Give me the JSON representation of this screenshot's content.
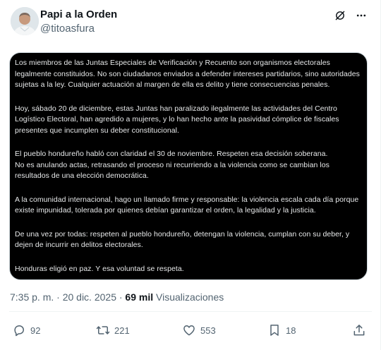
{
  "author": {
    "display_name": "Papi a la Orden",
    "handle": "@titoasfura"
  },
  "post": {
    "paragraphs": [
      "Los miembros de las Juntas Especiales de Verificación y Recuento son organismos electorales legalmente constituidos. No son ciudadanos enviados a defender intereses partidarios, sino autoridades sujetas a la ley. Cualquier actuación al margen de ella es delito y tiene consecuencias penales.",
      "Hoy, sábado 20 de diciembre, estas Juntas han paralizado ilegalmente las actividades del Centro Logístico Electoral, han agredido a mujeres, y lo han hecho ante la pasividad cómplice de fiscales presentes que incumplen su deber constitucional.",
      "El pueblo hondureño habló con claridad el 30 de noviembre. Respeten esa decisión soberana.\nNo es anulando actas, retrasando el proceso ni recurriendo a la violencia como se cambian los resultados de una elección democrática.",
      "A la comunidad internacional, hago un llamado firme y responsable: la violencia escala cada día porque existe impunidad, tolerada por quienes debían garantizar el orden, la legalidad y la justicia.",
      "De una vez por todas: respeten al pueblo hondureño, detengan la violencia, cumplan con su deber, y dejen de incurrir en delitos electorales.",
      "Honduras eligió en paz. Y esa voluntad se respeta."
    ]
  },
  "meta": {
    "timestamp": "7:35 p. m. · 20 dic. 2025 ·",
    "views_count": "69 mil",
    "views_label": "Visualizaciones"
  },
  "actions": {
    "replies": "92",
    "reposts": "221",
    "likes": "553",
    "bookmarks": "18"
  },
  "icons": {
    "top": [
      "grok-icon",
      "more-icon"
    ],
    "actions": [
      "reply-icon",
      "repost-icon",
      "like-icon",
      "bookmark-icon",
      "share-icon"
    ]
  },
  "colors": {
    "card_background": "#000000",
    "card_text": "#e7e9ea",
    "secondary_text": "#536471",
    "primary_text": "#0f1419"
  }
}
